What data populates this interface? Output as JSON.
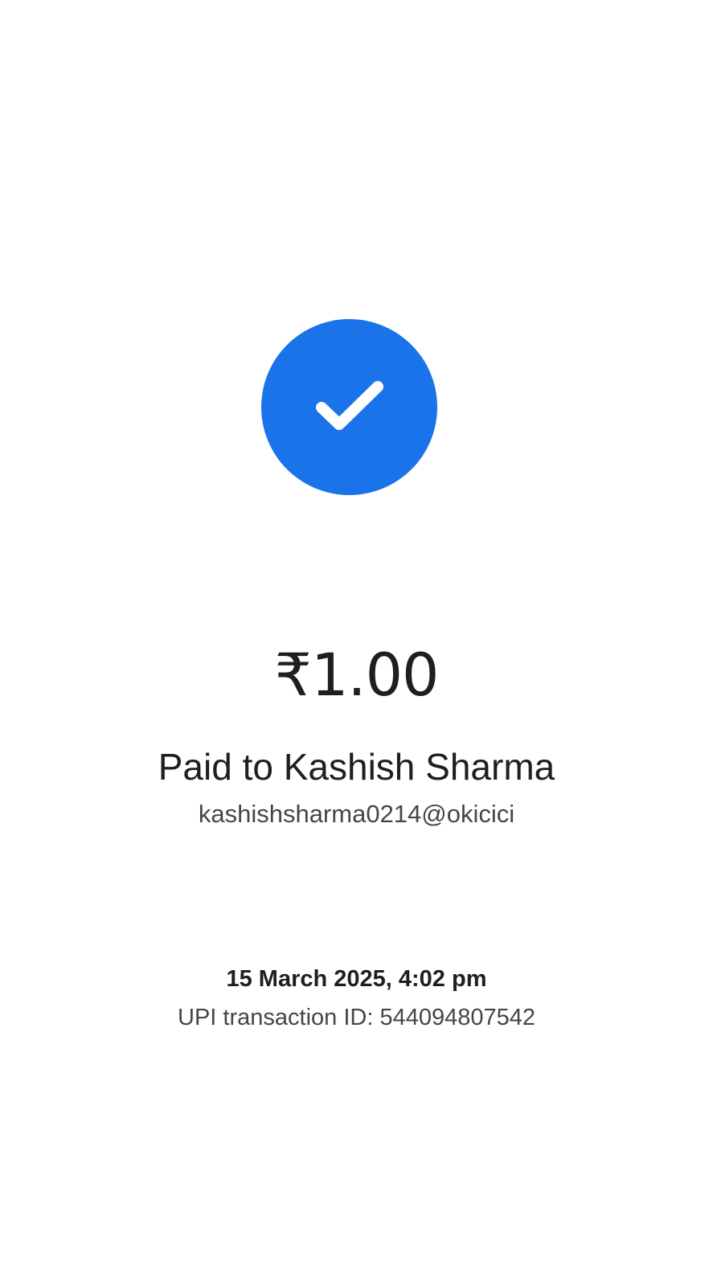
{
  "status": {
    "icon": "check-icon",
    "color": "#1a73e8"
  },
  "payment": {
    "amount": "₹1.00",
    "paid_to": "Paid to Kashish Sharma",
    "upi_id": "kashishsharma0214@okicici"
  },
  "details": {
    "datetime": "15 March 2025, 4:02 pm",
    "transaction_id": "UPI transaction ID: 544094807542"
  }
}
